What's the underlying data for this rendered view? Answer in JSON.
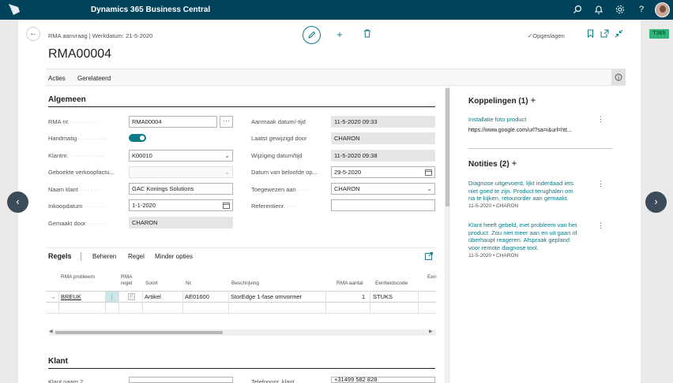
{
  "app": {
    "title": "Dynamics 365 Business Central",
    "tag": "T365"
  },
  "topbar_icons": [
    "search-icon",
    "bell-icon",
    "gear-icon",
    "help-icon"
  ],
  "header": {
    "breadcrumb": "RMA aanvraag | Werkdatum: 21-5-2020",
    "saved": "Opgeslagen",
    "record_title": "RMA00004"
  },
  "actions": [
    "Acties",
    "Gerelateerd"
  ],
  "general": {
    "title": "Algemeen",
    "left": [
      {
        "label": "RMA nr.",
        "value": "RMA00004"
      },
      {
        "label": "Handmatig",
        "value": ""
      },
      {
        "label": "Klantnr.",
        "value": "K00010"
      },
      {
        "label": "Geboekte verkoopfactu...",
        "value": ""
      },
      {
        "label": "Naam klant",
        "value": "GAC Konings Solutions"
      },
      {
        "label": "Inkoopdatum",
        "value": "1-1-2020"
      },
      {
        "label": "Gemaakt door",
        "value": "CHARON"
      }
    ],
    "right": [
      {
        "label": "Aanmaak datum/-tijd",
        "value": "11-5-2020 09:33"
      },
      {
        "label": "Laatst gewijzigd door",
        "value": "CHARON"
      },
      {
        "label": "Wijziging datum/tijd",
        "value": "11-5-2020 09:38"
      },
      {
        "label": "Datum van beloofde op...",
        "value": "29-5-2020"
      },
      {
        "label": "Toegewezen aan",
        "value": "CHARON"
      },
      {
        "label": "Referentienr.",
        "value": ""
      }
    ]
  },
  "lines": {
    "title": "Regels",
    "tabs": [
      "Beheren",
      "Regel",
      "Minder opties"
    ],
    "columns": [
      "RMA probleem",
      "RMA regel",
      "Soort",
      "Nr.",
      "Beschrijving",
      "RMA aantal",
      "Eenheidscode",
      "Een"
    ],
    "row": {
      "probleem": "BREUK",
      "soort": "Artikel",
      "nr": "AE01600",
      "beschrijving": "StorEdge 1-fase omvormer",
      "aantal": "1",
      "eenheid": "STUKS"
    }
  },
  "customer": {
    "title": "Klant",
    "left_label": "Klant naam 2",
    "right_label": "Telefoonnr. klant",
    "right_value": "+31499 582 828"
  },
  "factbox": {
    "links_title": "Koppelingen (1)",
    "link_name": "Installatie foto product",
    "link_url": "https://www.google.com/url?sa=i&url=htt...",
    "notes_title": "Notities (2)",
    "notes": [
      {
        "lines": [
          "Diagnose uitgevoerd, lijkt inderdaad iets",
          "niet goed te zijn. Product terughalen om",
          "na te kijken, retourorder aan gemaakt."
        ],
        "meta": "11-5-2020 • CHARON"
      },
      {
        "lines": [
          "Klant heeft gebeld, met probleem van het",
          "product. Zou niet meer aan en uit gaan of",
          "überhaupt reageren. Afspraak gepland",
          "voor remote diagnose tool."
        ],
        "meta": "11-5-2020 • CHARON"
      }
    ]
  },
  "colors": {
    "topbar": "#00435a",
    "accent": "#0c7a86",
    "tag": "#2fb37a"
  }
}
